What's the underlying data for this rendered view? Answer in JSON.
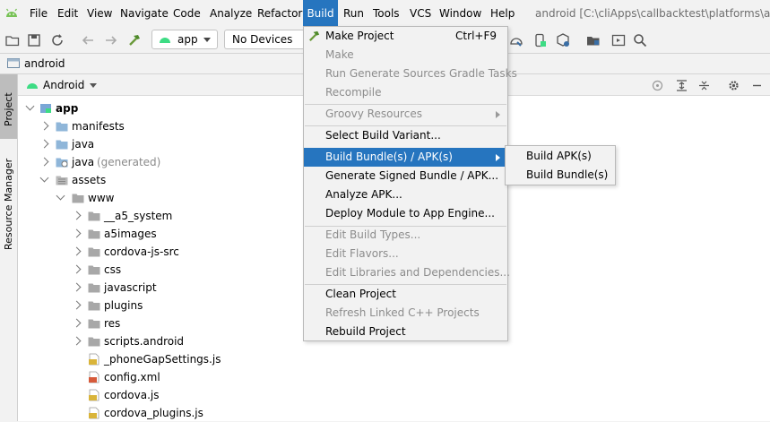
{
  "app": {
    "window_title": "android [C:\\cliApps\\callbacktest\\platforms\\andro"
  },
  "menubar": {
    "items": [
      "File",
      "Edit",
      "View",
      "Navigate",
      "Code",
      "Analyze",
      "Refactor",
      "Build",
      "Run",
      "Tools",
      "VCS",
      "Window",
      "Help"
    ],
    "active": "Build"
  },
  "toolbar": {
    "run_config": "app",
    "device": "No Devices"
  },
  "navbar": {
    "project_name": "android"
  },
  "sidebar": {
    "tabs": [
      "Project",
      "Resource Manager"
    ]
  },
  "project_panel": {
    "view_mode": "Android"
  },
  "tree": [
    {
      "label": "app",
      "depth": 0,
      "expanded": true,
      "icon": "app-module-icon",
      "bold": true
    },
    {
      "label": "manifests",
      "depth": 1,
      "expanded": false,
      "icon": "folder-icon"
    },
    {
      "label": "java",
      "depth": 1,
      "expanded": false,
      "icon": "folder-icon"
    },
    {
      "label": "java",
      "suffix": "(generated)",
      "depth": 1,
      "expanded": false,
      "icon": "generated-folder-icon"
    },
    {
      "label": "assets",
      "depth": 1,
      "expanded": true,
      "icon": "assets-folder-icon"
    },
    {
      "label": "www",
      "depth": 2,
      "expanded": true,
      "icon": "folder-gray-icon"
    },
    {
      "label": "__a5_system",
      "depth": 3,
      "expanded": false,
      "icon": "folder-gray-icon"
    },
    {
      "label": "a5images",
      "depth": 3,
      "expanded": false,
      "icon": "folder-gray-icon"
    },
    {
      "label": "cordova-js-src",
      "depth": 3,
      "expanded": false,
      "icon": "folder-gray-icon"
    },
    {
      "label": "css",
      "depth": 3,
      "expanded": false,
      "icon": "folder-gray-icon"
    },
    {
      "label": "javascript",
      "depth": 3,
      "expanded": false,
      "icon": "folder-gray-icon"
    },
    {
      "label": "plugins",
      "depth": 3,
      "expanded": false,
      "icon": "folder-gray-icon"
    },
    {
      "label": "res",
      "depth": 3,
      "expanded": false,
      "icon": "folder-gray-icon"
    },
    {
      "label": "scripts.android",
      "depth": 3,
      "expanded": false,
      "icon": "folder-gray-icon"
    },
    {
      "label": "_phoneGapSettings.js",
      "depth": 3,
      "leaf": true,
      "icon": "js-file-icon"
    },
    {
      "label": "config.xml",
      "depth": 3,
      "leaf": true,
      "icon": "xml-file-icon"
    },
    {
      "label": "cordova.js",
      "depth": 3,
      "leaf": true,
      "icon": "js-file-icon"
    },
    {
      "label": "cordova_plugins.js",
      "depth": 3,
      "leaf": true,
      "icon": "js-file-icon"
    }
  ],
  "build_menu": {
    "items": [
      {
        "label": "Make Project",
        "shortcut": "Ctrl+F9",
        "enabled": true,
        "icon": "hammer-icon"
      },
      {
        "label": "Make",
        "enabled": false
      },
      {
        "label": "Run Generate Sources Gradle Tasks",
        "enabled": false
      },
      {
        "label": "Recompile",
        "enabled": false
      },
      {
        "separator": true
      },
      {
        "label": "Groovy Resources",
        "enabled": false,
        "submenu": true
      },
      {
        "separator": true
      },
      {
        "label": "Select Build Variant...",
        "enabled": true
      },
      {
        "label": "Build Bundle(s) / APK(s)",
        "enabled": true,
        "submenu": true,
        "selected": true
      },
      {
        "label": "Generate Signed Bundle / APK...",
        "enabled": true
      },
      {
        "label": "Analyze APK...",
        "enabled": true
      },
      {
        "label": "Deploy Module to App Engine...",
        "enabled": true
      },
      {
        "separator": true
      },
      {
        "label": "Edit Build Types...",
        "enabled": false
      },
      {
        "label": "Edit Flavors...",
        "enabled": false
      },
      {
        "label": "Edit Libraries and Dependencies...",
        "enabled": false
      },
      {
        "separator": true
      },
      {
        "label": "Clean Project",
        "enabled": true
      },
      {
        "label": "Refresh Linked C++ Projects",
        "enabled": false
      },
      {
        "label": "Rebuild Project",
        "enabled": true
      }
    ]
  },
  "build_submenu": {
    "items": [
      "Build APK(s)",
      "Build Bundle(s)"
    ]
  },
  "colors": {
    "accent": "#2675bf",
    "background": "#f2f2f2",
    "disabled_text": "#8c8c8c",
    "android_green": "#3ddc84"
  }
}
